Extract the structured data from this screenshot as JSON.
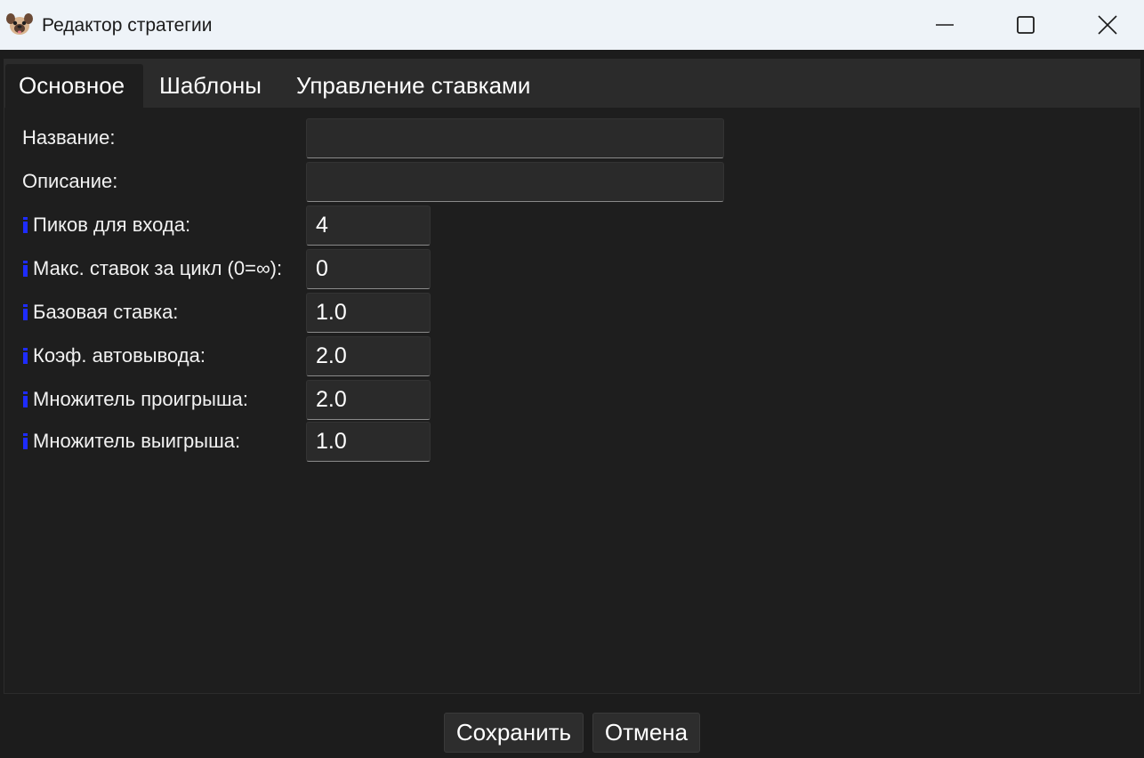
{
  "window": {
    "title": "Редактор стратегии",
    "icon": "pug-dog-icon"
  },
  "tabs": [
    {
      "label": "Основное",
      "active": true
    },
    {
      "label": "Шаблоны",
      "active": false
    },
    {
      "label": "Управление ставками",
      "active": false
    }
  ],
  "form": {
    "name": {
      "label": "Название:",
      "value": ""
    },
    "description": {
      "label": "Описание:",
      "value": ""
    },
    "entry_picks": {
      "label": "Пиков для входа:",
      "value": "4"
    },
    "max_bets_per_cycle": {
      "label": "Макс. ставок за цикл (0=∞):",
      "value": "0"
    },
    "base_bet": {
      "label": "Базовая ставка:",
      "value": "1.0"
    },
    "auto_cashout_coef": {
      "label": "Коэф. автовывода:",
      "value": "2.0"
    },
    "loss_multiplier": {
      "label": "Множитель проигрыша:",
      "value": "2.0"
    },
    "win_multiplier": {
      "label": "Множитель выигрыша:",
      "value": "1.0"
    }
  },
  "buttons": {
    "save": "Сохранить",
    "cancel": "Отмена"
  },
  "colors": {
    "titlebar_bg": "#eef3f8",
    "window_bg": "#1c1c1c",
    "tab_strip_bg": "#2b2b2b",
    "field_bg": "#2a2a2a",
    "info_icon": "#1e2cff"
  }
}
